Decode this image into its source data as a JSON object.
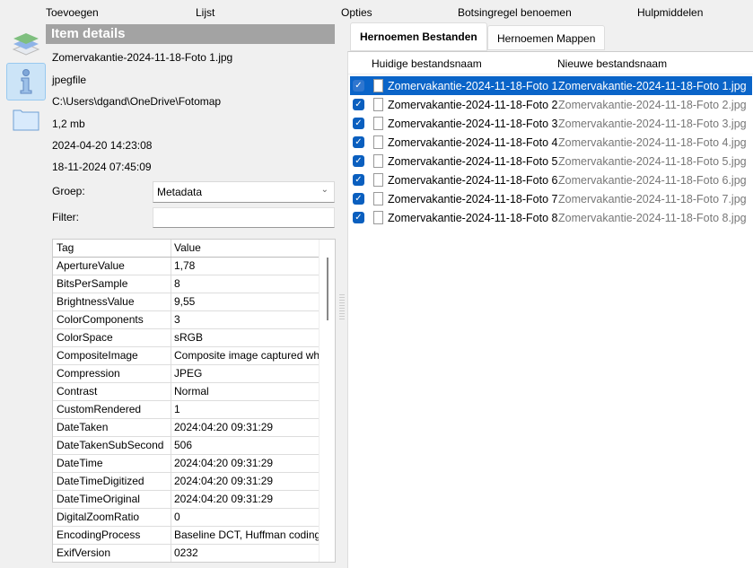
{
  "menu": [
    "Toevoegen",
    "Lijst",
    "Opties",
    "Botsingregel benoemen",
    "Hulpmiddelen"
  ],
  "panel_title": "Item details",
  "details": {
    "name": "Zomervakantie-2024-11-18-Foto 1.jpg",
    "type": "jpegfile",
    "path": "C:\\Users\\dgand\\OneDrive\\Fotomap",
    "size": "1,2 mb",
    "created": "2024-04-20 14:23:08",
    "modified": "18-11-2024 07:45:09"
  },
  "group_label": "Groep:",
  "group_value": "Metadata",
  "filter_label": "Filter:",
  "filter_value": "",
  "meta_headers": [
    "Tag",
    "Value"
  ],
  "meta": [
    [
      "ApertureValue",
      "1,78"
    ],
    [
      "BitsPerSample",
      "8"
    ],
    [
      "BrightnessValue",
      "9,55"
    ],
    [
      "ColorComponents",
      "3"
    ],
    [
      "ColorSpace",
      "sRGB"
    ],
    [
      "CompositeImage",
      "Composite image captured wh"
    ],
    [
      "Compression",
      "JPEG"
    ],
    [
      "Contrast",
      "Normal"
    ],
    [
      "CustomRendered",
      "1"
    ],
    [
      "DateTaken",
      "2024:04:20 09:31:29"
    ],
    [
      "DateTakenSubSecond",
      "506"
    ],
    [
      "DateTime",
      "2024:04:20 09:31:29"
    ],
    [
      "DateTimeDigitized",
      "2024:04:20 09:31:29"
    ],
    [
      "DateTimeOriginal",
      "2024:04:20 09:31:29"
    ],
    [
      "DigitalZoomRatio",
      "0"
    ],
    [
      "EncodingProcess",
      "Baseline DCT, Huffman coding"
    ],
    [
      "ExifVersion",
      "0232"
    ]
  ],
  "tabs": [
    "Hernoemen Bestanden",
    "Hernoemen Mappen"
  ],
  "list_headers": [
    "Huidige bestandsnaam",
    "Nieuwe bestandsnaam"
  ],
  "files": [
    [
      "Zomervakantie-2024-11-18-Foto 1...",
      "Zomervakantie-2024-11-18-Foto 1.jpg"
    ],
    [
      "Zomervakantie-2024-11-18-Foto 2...",
      "Zomervakantie-2024-11-18-Foto 2.jpg"
    ],
    [
      "Zomervakantie-2024-11-18-Foto 3...",
      "Zomervakantie-2024-11-18-Foto 3.jpg"
    ],
    [
      "Zomervakantie-2024-11-18-Foto 4...",
      "Zomervakantie-2024-11-18-Foto 4.jpg"
    ],
    [
      "Zomervakantie-2024-11-18-Foto 5...",
      "Zomervakantie-2024-11-18-Foto 5.jpg"
    ],
    [
      "Zomervakantie-2024-11-18-Foto 6...",
      "Zomervakantie-2024-11-18-Foto 6.jpg"
    ],
    [
      "Zomervakantie-2024-11-18-Foto 7...",
      "Zomervakantie-2024-11-18-Foto 7.jpg"
    ],
    [
      "Zomervakantie-2024-11-18-Foto 8...",
      "Zomervakantie-2024-11-18-Foto 8.jpg"
    ]
  ]
}
